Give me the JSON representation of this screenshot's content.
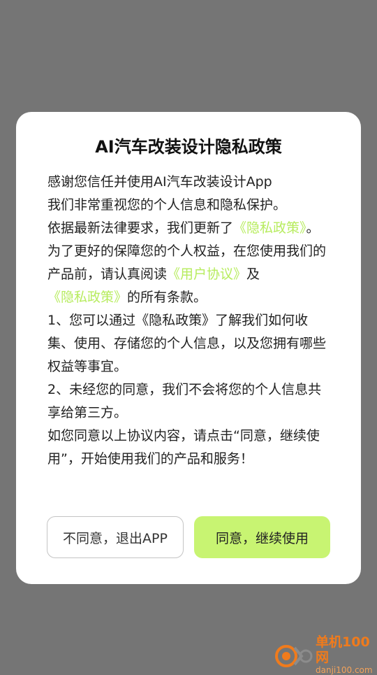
{
  "dialog": {
    "title": "AI汽车改装设计隐私政策",
    "p1": "感谢您信任并使用AI汽车改装设计App",
    "p2": "我们非常重视您的个人信息和隐私保护。",
    "p3_pre": "依据最新法律要求，我们更新了",
    "p3_link": "《隐私政策》",
    "p3_post": "。",
    "p4_pre": "为了更好的保障您的个人权益，在您使用我们的产品前，请认真阅读",
    "p4_link1": "《用户协议》",
    "p4_mid": "及",
    "p4_link2": "《隐私政策》",
    "p4_post": "的所有条款。",
    "p5": "1、您可以通过《隐私政策》了解我们如何收集、使用、存储您的个人信息，以及您拥有哪些权益等事宜。",
    "p6": "2、未经您的同意，我们不会将您的个人信息共享给第三方。",
    "p7": "如您同意以上协议内容，请点击“同意，继续使用”，开始使用我们的产品和服务！",
    "decline_label": "不同意，退出APP",
    "agree_label": "同意，继续使用"
  },
  "watermark": {
    "name": "单机100网",
    "url": "danji100.com"
  },
  "colors": {
    "overlay": "#757575",
    "link": "#b7ec5e",
    "agree_button": "#c8f472",
    "watermark": "#f07b1c"
  }
}
